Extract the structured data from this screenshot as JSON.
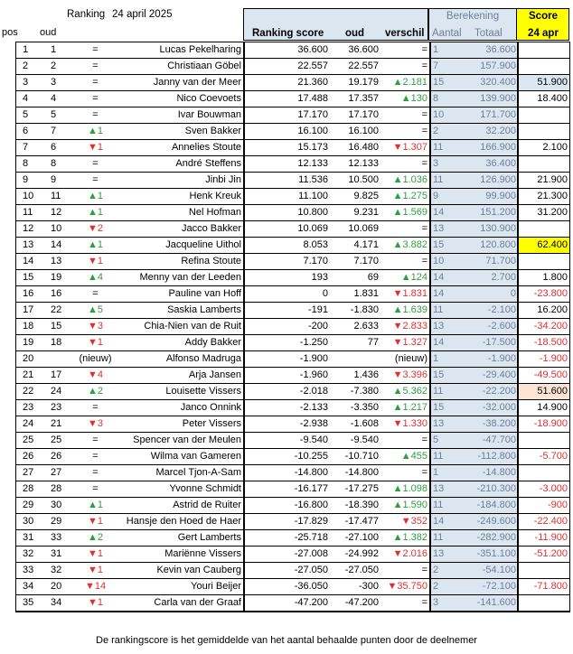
{
  "header": {
    "title": "Ranking",
    "date": "24 april 2025",
    "col_pos": "pos",
    "col_oud": "oud",
    "col_ranking_score": "Ranking score",
    "col_oud2": "oud",
    "col_verschil": "verschil",
    "berekening": "Berekening",
    "col_aantal": "Aantal",
    "col_totaal": "Totaal",
    "score": "Score",
    "score_date": "24 apr"
  },
  "colors": {
    "up": "#2e9e3f",
    "down": "#e03030",
    "blue_panel": "#dce6f1",
    "highlight": "#ffff00",
    "peach": "#fde4d5"
  },
  "rows": [
    {
      "pos": "1",
      "oud": "1",
      "mv": "=",
      "dir": "eq",
      "name": "Lucas Pekelharing",
      "score": "36.600",
      "oudv": "36.600",
      "vs": "=",
      "vsdir": "eq",
      "aantal": "1",
      "totaal": "36.600",
      "sc": "",
      "scbg": ""
    },
    {
      "pos": "2",
      "oud": "2",
      "mv": "=",
      "dir": "eq",
      "name": "Christiaan Göbel",
      "score": "22.557",
      "oudv": "22.557",
      "vs": "=",
      "vsdir": "eq",
      "aantal": "7",
      "totaal": "157.900",
      "sc": "",
      "scbg": ""
    },
    {
      "pos": "3",
      "oud": "3",
      "mv": "=",
      "dir": "eq",
      "name": "Janny van der Meer",
      "score": "21.360",
      "oudv": "19.179",
      "vs": "▲2.181",
      "vsdir": "up",
      "aantal": "15",
      "totaal": "320.400",
      "sc": "51.900",
      "scbg": "blue"
    },
    {
      "pos": "4",
      "oud": "4",
      "mv": "=",
      "dir": "eq",
      "name": "Nico Coevoets",
      "score": "17.488",
      "oudv": "17.357",
      "vs": "▲130",
      "vsdir": "up",
      "aantal": "8",
      "totaal": "139.900",
      "sc": "18.400",
      "scbg": ""
    },
    {
      "pos": "5",
      "oud": "5",
      "mv": "=",
      "dir": "eq",
      "name": "Ivar Bouwman",
      "score": "17.170",
      "oudv": "17.170",
      "vs": "=",
      "vsdir": "eq",
      "aantal": "10",
      "totaal": "171.700",
      "sc": "",
      "scbg": ""
    },
    {
      "pos": "6",
      "oud": "7",
      "mv": "▲1",
      "dir": "up",
      "name": "Sven Bakker",
      "score": "16.100",
      "oudv": "16.100",
      "vs": "=",
      "vsdir": "eq",
      "aantal": "2",
      "totaal": "32.200",
      "sc": "",
      "scbg": ""
    },
    {
      "pos": "7",
      "oud": "6",
      "mv": "▼1",
      "dir": "down",
      "name": "Annelies Stoute",
      "score": "15.173",
      "oudv": "16.480",
      "vs": "▼1.307",
      "vsdir": "down",
      "aantal": "11",
      "totaal": "166.900",
      "sc": "2.100",
      "scbg": ""
    },
    {
      "pos": "8",
      "oud": "8",
      "mv": "=",
      "dir": "eq",
      "name": "André Steffens",
      "score": "12.133",
      "oudv": "12.133",
      "vs": "=",
      "vsdir": "eq",
      "aantal": "3",
      "totaal": "36.400",
      "sc": "",
      "scbg": ""
    },
    {
      "pos": "9",
      "oud": "9",
      "mv": "=",
      "dir": "eq",
      "name": "Jinbi Jin",
      "score": "11.536",
      "oudv": "10.500",
      "vs": "▲1.036",
      "vsdir": "up",
      "aantal": "11",
      "totaal": "126.900",
      "sc": "21.900",
      "scbg": ""
    },
    {
      "pos": "10",
      "oud": "11",
      "mv": "▲1",
      "dir": "up",
      "name": "Henk Kreuk",
      "score": "11.100",
      "oudv": "9.825",
      "vs": "▲1.275",
      "vsdir": "up",
      "aantal": "9",
      "totaal": "99.900",
      "sc": "21.300",
      "scbg": ""
    },
    {
      "pos": "11",
      "oud": "12",
      "mv": "▲1",
      "dir": "up",
      "name": "Nel Hofman",
      "score": "10.800",
      "oudv": "9.231",
      "vs": "▲1.569",
      "vsdir": "up",
      "aantal": "14",
      "totaal": "151.200",
      "sc": "31.200",
      "scbg": ""
    },
    {
      "pos": "12",
      "oud": "10",
      "mv": "▼2",
      "dir": "down",
      "name": "Jacco Bakker",
      "score": "10.069",
      "oudv": "10.069",
      "vs": "=",
      "vsdir": "eq",
      "aantal": "13",
      "totaal": "130.900",
      "sc": "",
      "scbg": ""
    },
    {
      "pos": "13",
      "oud": "14",
      "mv": "▲1",
      "dir": "up",
      "name": "Jacqueline Uithol",
      "score": "8.053",
      "oudv": "4.171",
      "vs": "▲3.882",
      "vsdir": "up",
      "aantal": "15",
      "totaal": "120.800",
      "sc": "62.400",
      "scbg": "yellow"
    },
    {
      "pos": "14",
      "oud": "13",
      "mv": "▼1",
      "dir": "down",
      "name": "Refina Stoute",
      "score": "7.170",
      "oudv": "7.170",
      "vs": "=",
      "vsdir": "eq",
      "aantal": "10",
      "totaal": "71.700",
      "sc": "",
      "scbg": ""
    },
    {
      "pos": "15",
      "oud": "19",
      "mv": "▲4",
      "dir": "up",
      "name": "Menny van der Leeden",
      "score": "193",
      "oudv": "69",
      "vs": "▲124",
      "vsdir": "up",
      "aantal": "14",
      "totaal": "2.700",
      "sc": "1.800",
      "scbg": ""
    },
    {
      "pos": "16",
      "oud": "16",
      "mv": "=",
      "dir": "eq",
      "name": "Pauline van Hoff",
      "score": "0",
      "oudv": "1.831",
      "vs": "▼1.831",
      "vsdir": "down",
      "aantal": "14",
      "totaal": "0",
      "sc": "-23.800",
      "scbg": ""
    },
    {
      "pos": "17",
      "oud": "22",
      "mv": "▲5",
      "dir": "up",
      "name": "Saskia Lamberts",
      "score": "-191",
      "oudv": "-1.830",
      "vs": "▲1.639",
      "vsdir": "up",
      "aantal": "11",
      "totaal": "-2.100",
      "sc": "16.200",
      "scbg": ""
    },
    {
      "pos": "18",
      "oud": "15",
      "mv": "▼3",
      "dir": "down",
      "name": "Chia-Nien van de Ruit",
      "score": "-200",
      "oudv": "2.633",
      "vs": "▼2.833",
      "vsdir": "down",
      "aantal": "13",
      "totaal": "-2.600",
      "sc": "-34.200",
      "scbg": ""
    },
    {
      "pos": "19",
      "oud": "18",
      "mv": "▼1",
      "dir": "down",
      "name": "Addy Bakker",
      "score": "-1.250",
      "oudv": "77",
      "vs": "▼1.327",
      "vsdir": "down",
      "aantal": "14",
      "totaal": "-17.500",
      "sc": "-18.500",
      "scbg": ""
    },
    {
      "pos": "20",
      "oud": "",
      "mv": "(nieuw)",
      "dir": "eq",
      "name": "Alfonso Madruga",
      "score": "-1.900",
      "oudv": "",
      "vs": "(nieuw)",
      "vsdir": "eq",
      "aantal": "1",
      "totaal": "-1.900",
      "sc": "-1.900",
      "scbg": ""
    },
    {
      "pos": "21",
      "oud": "17",
      "mv": "▼4",
      "dir": "down",
      "name": "Arja Jansen",
      "score": "-1.960",
      "oudv": "1.436",
      "vs": "▼3.396",
      "vsdir": "down",
      "aantal": "15",
      "totaal": "-29.400",
      "sc": "-49.500",
      "scbg": ""
    },
    {
      "pos": "22",
      "oud": "24",
      "mv": "▲2",
      "dir": "up",
      "name": "Louisette Vissers",
      "score": "-2.018",
      "oudv": "-7.380",
      "vs": "▲5.362",
      "vsdir": "up",
      "aantal": "11",
      "totaal": "-22.200",
      "sc": "51.600",
      "scbg": "peach"
    },
    {
      "pos": "23",
      "oud": "23",
      "mv": "=",
      "dir": "eq",
      "name": "Janco Onnink",
      "score": "-2.133",
      "oudv": "-3.350",
      "vs": "▲1.217",
      "vsdir": "up",
      "aantal": "15",
      "totaal": "-32.000",
      "sc": "14.900",
      "scbg": ""
    },
    {
      "pos": "24",
      "oud": "21",
      "mv": "▼3",
      "dir": "down",
      "name": "Peter Vissers",
      "score": "-2.938",
      "oudv": "-1.608",
      "vs": "▼1.330",
      "vsdir": "down",
      "aantal": "13",
      "totaal": "-38.200",
      "sc": "-18.900",
      "scbg": ""
    },
    {
      "pos": "25",
      "oud": "25",
      "mv": "=",
      "dir": "eq",
      "name": "Spencer van der Meulen",
      "score": "-9.540",
      "oudv": "-9.540",
      "vs": "=",
      "vsdir": "eq",
      "aantal": "5",
      "totaal": "-47.700",
      "sc": "",
      "scbg": ""
    },
    {
      "pos": "26",
      "oud": "26",
      "mv": "=",
      "dir": "eq",
      "name": "Wilma van Gameren",
      "score": "-10.255",
      "oudv": "-10.710",
      "vs": "▲455",
      "vsdir": "up",
      "aantal": "11",
      "totaal": "-112.800",
      "sc": "-5.700",
      "scbg": ""
    },
    {
      "pos": "27",
      "oud": "27",
      "mv": "=",
      "dir": "eq",
      "name": "Marcel Tjon-A-Sam",
      "score": "-14.800",
      "oudv": "-14.800",
      "vs": "=",
      "vsdir": "eq",
      "aantal": "1",
      "totaal": "-14.800",
      "sc": "",
      "scbg": ""
    },
    {
      "pos": "28",
      "oud": "28",
      "mv": "=",
      "dir": "eq",
      "name": "Yvonne Schmidt",
      "score": "-16.177",
      "oudv": "-17.275",
      "vs": "▲1.098",
      "vsdir": "up",
      "aantal": "13",
      "totaal": "-210.300",
      "sc": "-3.000",
      "scbg": ""
    },
    {
      "pos": "29",
      "oud": "30",
      "mv": "▲1",
      "dir": "up",
      "name": "Astrid de Ruiter",
      "score": "-16.800",
      "oudv": "-18.390",
      "vs": "▲1.590",
      "vsdir": "up",
      "aantal": "11",
      "totaal": "-184.800",
      "sc": "-900",
      "scbg": ""
    },
    {
      "pos": "30",
      "oud": "29",
      "mv": "▼1",
      "dir": "down",
      "name": "Hansje den Hoed de Haer",
      "score": "-17.829",
      "oudv": "-17.477",
      "vs": "▼352",
      "vsdir": "down",
      "aantal": "14",
      "totaal": "-249.600",
      "sc": "-22.400",
      "scbg": ""
    },
    {
      "pos": "31",
      "oud": "33",
      "mv": "▲2",
      "dir": "up",
      "name": "Gert Lamberts",
      "score": "-25.718",
      "oudv": "-27.100",
      "vs": "▲1.382",
      "vsdir": "up",
      "aantal": "11",
      "totaal": "-282.900",
      "sc": "-11.900",
      "scbg": ""
    },
    {
      "pos": "32",
      "oud": "31",
      "mv": "▼1",
      "dir": "down",
      "name": "Mariënne Vissers",
      "score": "-27.008",
      "oudv": "-24.992",
      "vs": "▼2.016",
      "vsdir": "down",
      "aantal": "13",
      "totaal": "-351.100",
      "sc": "-51.200",
      "scbg": ""
    },
    {
      "pos": "33",
      "oud": "32",
      "mv": "▼1",
      "dir": "down",
      "name": "Kevin van Cauberg",
      "score": "-27.050",
      "oudv": "-27.050",
      "vs": "=",
      "vsdir": "eq",
      "aantal": "2",
      "totaal": "-54.100",
      "sc": "",
      "scbg": ""
    },
    {
      "pos": "34",
      "oud": "20",
      "mv": "▼14",
      "dir": "down",
      "name": "Youri Beijer",
      "score": "-36.050",
      "oudv": "-300",
      "vs": "▼35.750",
      "vsdir": "down",
      "aantal": "2",
      "totaal": "-72.100",
      "sc": "-71.800",
      "scbg": ""
    },
    {
      "pos": "35",
      "oud": "34",
      "mv": "▼1",
      "dir": "down",
      "name": "Carla van der Graaf",
      "score": "-47.200",
      "oudv": "-47.200",
      "vs": "=",
      "vsdir": "eq",
      "aantal": "3",
      "totaal": "-141.600",
      "sc": "",
      "scbg": ""
    }
  ],
  "footer": "De rankingscore is het gemiddelde van het aantal behaalde punten door de deelnemer"
}
